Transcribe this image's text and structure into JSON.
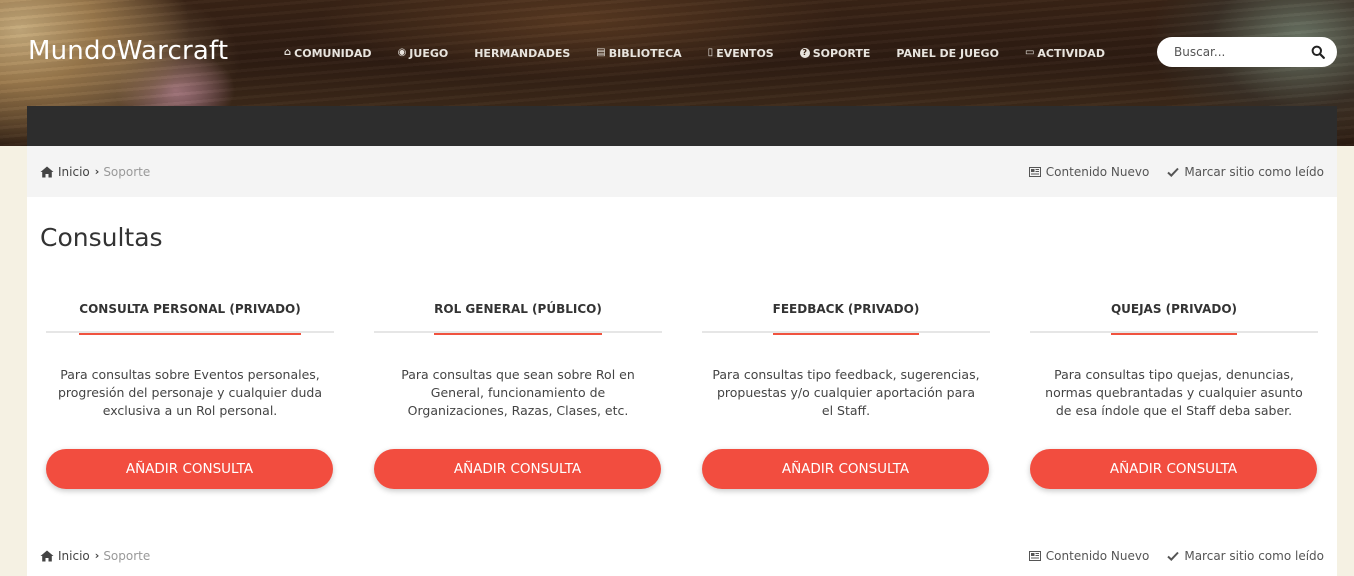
{
  "site": {
    "title": "MundoWarcraft"
  },
  "nav": [
    {
      "label": "COMUNIDAD",
      "icon": "home-icon",
      "glyph": "⌂"
    },
    {
      "label": "JUEGO",
      "icon": "gamepad-icon",
      "glyph": "◉"
    },
    {
      "label": "HERMANDADES",
      "icon": "",
      "glyph": ""
    },
    {
      "label": "BIBLIOTECA",
      "icon": "book-icon",
      "glyph": "▤"
    },
    {
      "label": "EVENTOS",
      "icon": "calendar-icon",
      "glyph": "▯"
    },
    {
      "label": "SOPORTE",
      "icon": "question-circle-icon",
      "glyph": "?"
    },
    {
      "label": "PANEL DE JUEGO",
      "icon": "",
      "glyph": ""
    },
    {
      "label": "ACTIVIDAD",
      "icon": "keyboard-icon",
      "glyph": "▭"
    }
  ],
  "search": {
    "placeholder": "Buscar..."
  },
  "breadcrumb": {
    "home": "Inicio",
    "current": "Soporte",
    "new_content": "Contenido Nuevo",
    "mark_read": "Marcar sitio como leído"
  },
  "page": {
    "title": "Consultas"
  },
  "cards": [
    {
      "title": "CONSULTA PERSONAL (PRIVADO)",
      "desc": "Para consultas sobre Eventos personales, progresión del personaje y cualquier duda exclusiva a un Rol personal.",
      "button": "AÑADIR CONSULTA"
    },
    {
      "title": "ROL GENERAL (PÚBLICO)",
      "desc": "Para consultas que sean sobre Rol en General, funcionamiento de Organizaciones, Razas, Clases, etc.",
      "button": "AÑADIR CONSULTA"
    },
    {
      "title": "FEEDBACK (PRIVADO)",
      "desc": "Para consultas tipo feedback, sugerencias, propuestas y/o cualquier aportación para el Staff.",
      "button": "AÑADIR CONSULTA"
    },
    {
      "title": "QUEJAS (PRIVADO)",
      "desc": "Para consultas tipo quejas, denuncias, normas quebrantadas y cualquier asunto de esa índole que el Staff deba saber.",
      "button": "AÑADIR CONSULTA"
    }
  ],
  "colors": {
    "accent": "#f24d3f",
    "dark_bar": "#2d2d2d",
    "page_bg": "#f5f1e3"
  }
}
